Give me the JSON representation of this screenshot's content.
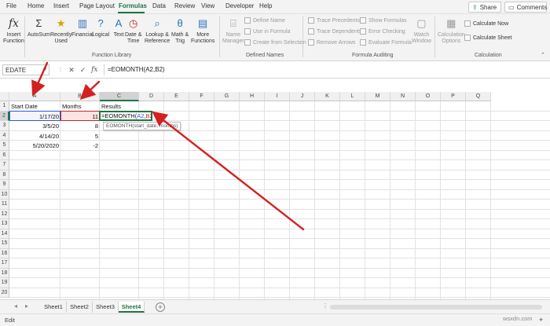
{
  "menu": {
    "tabs": [
      "File",
      "Home",
      "Insert",
      "Page Layout",
      "Formulas",
      "Data",
      "Review",
      "View",
      "Developer",
      "Help"
    ],
    "active": "Formulas",
    "share_label": "Share",
    "comments_label": "Comments"
  },
  "ribbon": {
    "insert_function": [
      "Insert",
      "Function"
    ],
    "autosum": "AutoSum",
    "recently_used": [
      "Recently",
      "Used"
    ],
    "financial": "Financial",
    "logical": "Logical",
    "text": "Text",
    "date_time": [
      "Date &",
      "Time"
    ],
    "lookup": [
      "Lookup &",
      "Reference"
    ],
    "math": [
      "Math &",
      "Trig"
    ],
    "more": [
      "More",
      "Functions"
    ],
    "group_function_library": "Function Library",
    "name_manager": [
      "Name",
      "Manager"
    ],
    "define_name": "Define Name",
    "use_in_formula": "Use in Formula",
    "create_from_selection": "Create from Selection",
    "group_defined_names": "Defined Names",
    "trace_precedents": "Trace Precedents",
    "trace_dependents": "Trace Dependents",
    "remove_arrows": "Remove Arrows",
    "show_formulas": "Show Formulas",
    "error_checking": "Error Checking",
    "evaluate_formula": "Evaluate Formula",
    "watch_window": [
      "Watch",
      "Window"
    ],
    "group_formula_auditing": "Formula Auditing",
    "calc_options": [
      "Calculation",
      "Options"
    ],
    "calculate_now": "Calculate Now",
    "calculate_sheet": "Calculate Sheet",
    "group_calculation": "Calculation"
  },
  "formula_bar": {
    "name_box": "EDATE",
    "fx": "fx",
    "formula": "=EOMONTH(A2,B2)"
  },
  "grid": {
    "columns": [
      "A",
      "B",
      "C",
      "D",
      "E",
      "F",
      "G",
      "H",
      "I",
      "J",
      "K",
      "L",
      "M",
      "N",
      "O",
      "P",
      "Q"
    ],
    "rows": [
      "1",
      "2",
      "3",
      "4",
      "5",
      "6",
      "7",
      "8",
      "9",
      "10",
      "11",
      "12",
      "13",
      "14",
      "15",
      "16",
      "17",
      "18",
      "19",
      "20"
    ],
    "cells": {
      "A1": "Start Date",
      "B1": "Months",
      "C1": "Results",
      "A2": "1/17/20",
      "B2": "11",
      "C2_prefix": "=EOMONTH(",
      "C2_ref1": "A2",
      "C2_comma": ",",
      "C2_ref2": "B2",
      "C2_suffix": ")",
      "A3": "3/5/20",
      "B3": "8",
      "A4": "4/14/20",
      "B4": "5",
      "A5": "5/20/2020",
      "B5": "-2"
    },
    "tooltip": "EOMONTH(start_date, months)"
  },
  "sheets": {
    "tabs": [
      "Sheet1",
      "Sheet2",
      "Sheet3",
      "Sheet4"
    ],
    "active": "Sheet4",
    "add_label": "+"
  },
  "status": {
    "mode": "Edit",
    "zoom": "+"
  },
  "colors": {
    "accent": "#217346",
    "ref_blue": "#2e59d9",
    "ref_red": "#c0282d",
    "arrow": "#d42020"
  },
  "watermark": "wsxdn.com"
}
